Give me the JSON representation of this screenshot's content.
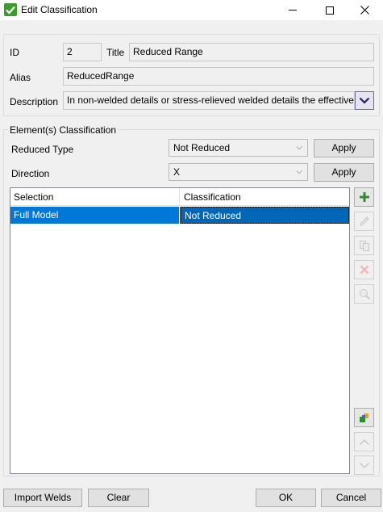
{
  "window": {
    "title": "Edit Classification",
    "minimize_icon": "minimize-icon",
    "maximize_icon": "maximize-icon",
    "close_icon": "close-icon"
  },
  "info": {
    "id_label": "ID",
    "id_value": "2",
    "title_label": "Title",
    "title_value": "Reduced Range",
    "alias_label": "Alias",
    "alias_value": "ReducedRange",
    "description_label": "Description",
    "description_value": "In non-welded details or stress-relieved welded details the effective"
  },
  "classification": {
    "group_title": "Element(s) Classification",
    "reduced_type_label": "Reduced Type",
    "reduced_type_value": "Not Reduced",
    "direction_label": "Direction",
    "direction_value": "X",
    "apply_label": "Apply"
  },
  "grid": {
    "columns": [
      "Selection",
      "Classification"
    ],
    "rows": [
      {
        "selection": "Full Model",
        "classification": "Not Reduced",
        "selected": true
      }
    ]
  },
  "side_toolbar": [
    "add-icon",
    "edit-icon",
    "copy-icon",
    "delete-icon",
    "zoom-icon",
    "paint-icon",
    "move-up-icon",
    "move-down-icon"
  ],
  "footer": {
    "import_welds_label": "Import Welds",
    "clear_label": "Clear",
    "ok_label": "OK",
    "cancel_label": "Cancel"
  },
  "colors": {
    "selection_highlight": "#0078d7",
    "add_green": "#2e8b2e",
    "app_icon": "#3c9a2e"
  }
}
